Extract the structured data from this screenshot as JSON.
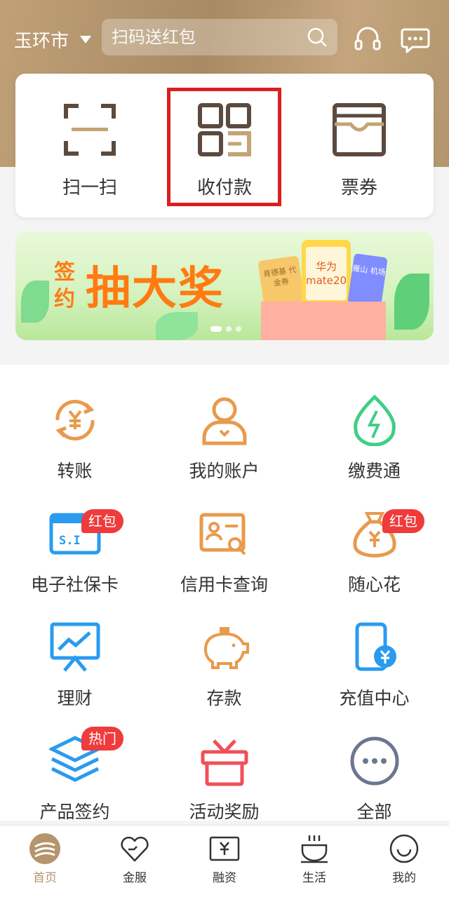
{
  "header": {
    "city": "玉环市",
    "search_placeholder": "扫码送红包"
  },
  "quick_actions": [
    {
      "label": "扫一扫",
      "icon": "scan-icon"
    },
    {
      "label": "收付款",
      "icon": "qr-payment-icon"
    },
    {
      "label": "票券",
      "icon": "coupon-icon"
    }
  ],
  "banner": {
    "small_text": "签约",
    "big_text": "抽大奖",
    "phone_text": "华为 mate20",
    "ticket1_text": "肯德基 代金券",
    "ticket2_text": "雁山 机场"
  },
  "services": [
    {
      "label": "转账",
      "icon": "transfer-icon",
      "badge": ""
    },
    {
      "label": "我的账户",
      "icon": "account-icon",
      "badge": ""
    },
    {
      "label": "缴费通",
      "icon": "payment-drop-icon",
      "badge": ""
    },
    {
      "label": "电子社保卡",
      "icon": "social-security-card-icon",
      "badge": "红包"
    },
    {
      "label": "信用卡查询",
      "icon": "credit-card-query-icon",
      "badge": ""
    },
    {
      "label": "随心花",
      "icon": "money-bag-icon",
      "badge": "红包"
    },
    {
      "label": "理财",
      "icon": "finance-chart-icon",
      "badge": ""
    },
    {
      "label": "存款",
      "icon": "piggy-bank-icon",
      "badge": ""
    },
    {
      "label": "充值中心",
      "icon": "phone-recharge-icon",
      "badge": ""
    },
    {
      "label": "产品签约",
      "icon": "layers-icon",
      "badge": "热门"
    },
    {
      "label": "活动奖励",
      "icon": "gift-icon",
      "badge": ""
    },
    {
      "label": "全部",
      "icon": "more-icon",
      "badge": ""
    }
  ],
  "nav": [
    {
      "label": "首页",
      "icon": "home-logo-icon",
      "active": true
    },
    {
      "label": "金服",
      "icon": "heart-icon",
      "active": false
    },
    {
      "label": "融资",
      "icon": "yuan-card-icon",
      "active": false
    },
    {
      "label": "生活",
      "icon": "cup-icon",
      "active": false
    },
    {
      "label": "我的",
      "icon": "smile-icon",
      "active": false
    }
  ],
  "colors": {
    "brand": "#b5956d",
    "orange": "#e89a4c",
    "green": "#3fcf86",
    "blue": "#2a9bef",
    "red": "#ef3b3b",
    "highlight": "#d9201e"
  }
}
